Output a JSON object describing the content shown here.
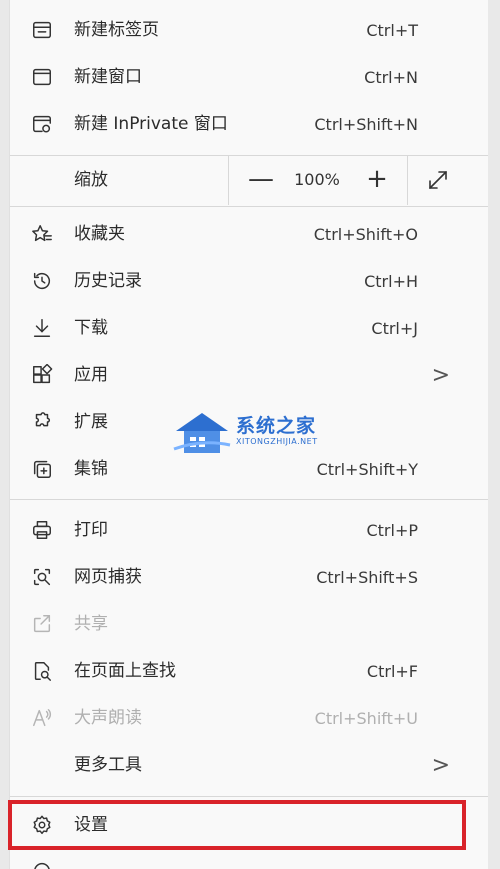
{
  "menu": {
    "new_tab": {
      "label": "新建标签页",
      "shortcut": "Ctrl+T"
    },
    "new_window": {
      "label": "新建窗口",
      "shortcut": "Ctrl+N"
    },
    "new_inprivate": {
      "label": "新建 InPrivate 窗口",
      "shortcut": "Ctrl+Shift+N"
    },
    "zoom": {
      "label": "缩放",
      "minus": "—",
      "value": "100%",
      "plus": "+"
    },
    "favorites": {
      "label": "收藏夹",
      "shortcut": "Ctrl+Shift+O"
    },
    "history": {
      "label": "历史记录",
      "shortcut": "Ctrl+H"
    },
    "downloads": {
      "label": "下载",
      "shortcut": "Ctrl+J"
    },
    "apps": {
      "label": "应用",
      "chevron": ">"
    },
    "extensions": {
      "label": "扩展"
    },
    "collections": {
      "label": "集锦",
      "shortcut": "Ctrl+Shift+Y"
    },
    "print": {
      "label": "打印",
      "shortcut": "Ctrl+P"
    },
    "web_capture": {
      "label": "网页捕获",
      "shortcut": "Ctrl+Shift+S"
    },
    "share": {
      "label": "共享"
    },
    "find": {
      "label": "在页面上查找",
      "shortcut": "Ctrl+F"
    },
    "read_aloud": {
      "label": "大声朗读",
      "shortcut": "Ctrl+Shift+U"
    },
    "more_tools": {
      "label": "更多工具",
      "chevron": ">"
    },
    "settings": {
      "label": "设置"
    }
  },
  "watermark": {
    "name": "系统之家",
    "url": "XITONGZHIJIA.NET"
  },
  "colors": {
    "highlight": "#d9232a",
    "watermark": "#2d6fd0"
  }
}
